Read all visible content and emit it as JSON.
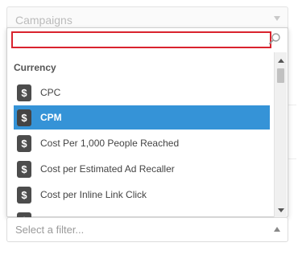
{
  "top_select": {
    "label": "Campaigns",
    "icon": "chevron-down-icon"
  },
  "search": {
    "value": "",
    "icon": "magnifier-icon"
  },
  "group": {
    "label": "Currency"
  },
  "options": [
    {
      "label": "CPC",
      "icon": "dollar-icon",
      "selected": false
    },
    {
      "label": "CPM",
      "icon": "dollar-icon",
      "selected": true
    },
    {
      "label": "Cost Per 1,000 People Reached",
      "icon": "dollar-icon",
      "selected": false
    },
    {
      "label": "Cost per Estimated Ad Recaller",
      "icon": "dollar-icon",
      "selected": false
    },
    {
      "label": "Cost per Inline Link Click",
      "icon": "dollar-icon",
      "selected": false
    }
  ],
  "dollar_glyph": "$",
  "bottom_select": {
    "placeholder": "Select a filter...",
    "icon": "chevron-up-icon"
  },
  "colors": {
    "selected_bg": "#3593d7",
    "search_border": "#d9232e",
    "icon_bg": "#4c4c4c"
  }
}
